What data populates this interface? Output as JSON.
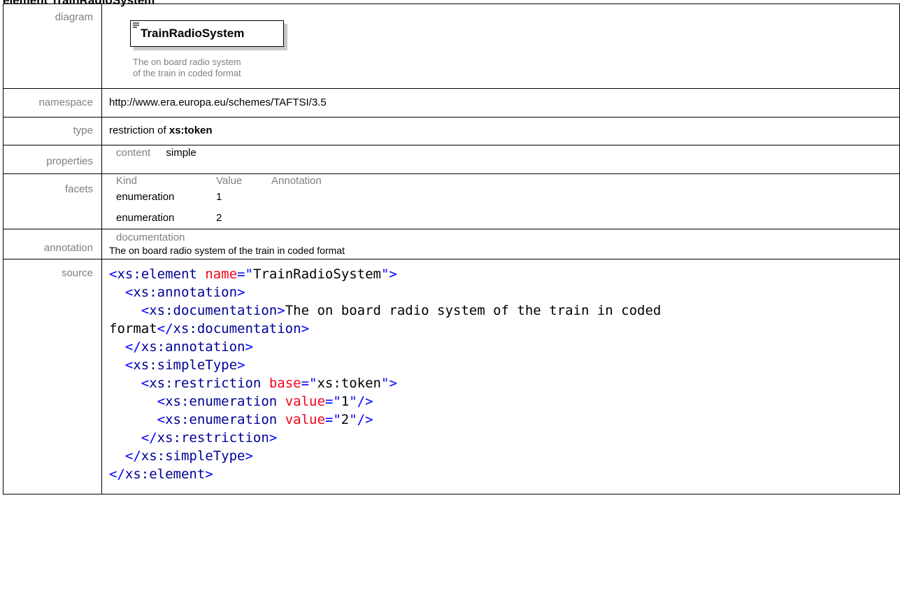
{
  "page": {
    "heading": "element TrainRadioSystem"
  },
  "labels": {
    "diagram": "diagram",
    "namespace": "namespace",
    "type": "type",
    "properties": "properties",
    "facets": "facets",
    "annotation": "annotation",
    "source": "source"
  },
  "diagram": {
    "element_name": "TrainRadioSystem",
    "description_line1": "The on board radio system",
    "description_line2": "of the train in coded format"
  },
  "namespace": "http://www.era.europa.eu/schemes/TAFTSI/3.5",
  "type": {
    "prefix": "restriction of",
    "base": "xs:token"
  },
  "properties": {
    "key": "content",
    "value": "simple"
  },
  "facets": {
    "headers": [
      "Kind",
      "Value",
      "Annotation"
    ],
    "rows": [
      {
        "kind": "enumeration",
        "value": "1",
        "annotation": ""
      },
      {
        "kind": "enumeration",
        "value": "2",
        "annotation": ""
      }
    ]
  },
  "annotation": {
    "header": "documentation",
    "text": "The on board radio system of the train in coded format"
  },
  "source": {
    "element_name_value": "TrainRadioSystem",
    "documentation_text_1": "The on board radio system of the train in coded",
    "documentation_text_2": "format",
    "restriction_base": "xs:token",
    "enum_1": "1",
    "enum_2": "2"
  }
}
